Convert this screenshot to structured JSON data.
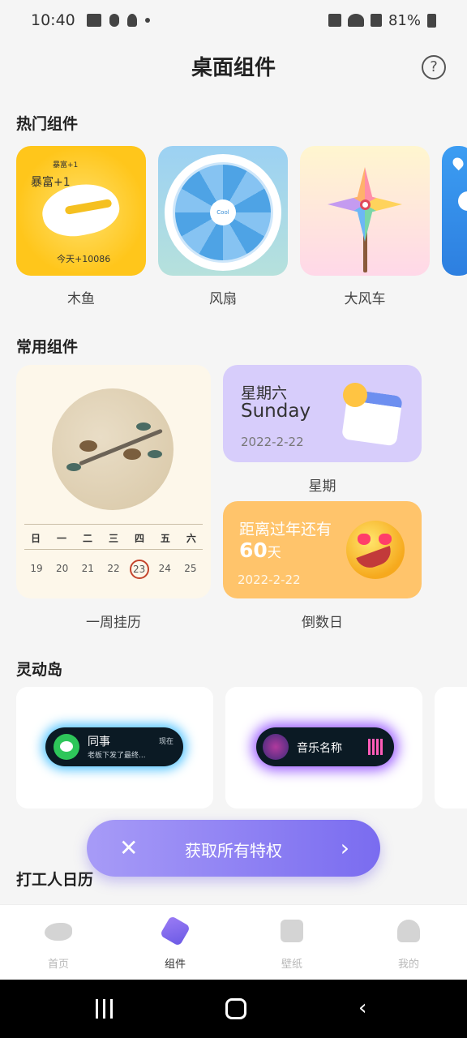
{
  "status": {
    "time": "10:40",
    "battery": "81%"
  },
  "header": {
    "title": "桌面组件",
    "help": "?"
  },
  "hot": {
    "title": "热门组件",
    "items": [
      {
        "label": "木鱼",
        "top_small": "暴富+1",
        "top": "暴富+1",
        "bottom": "今天+10086"
      },
      {
        "label": "风扇",
        "hub": "Cool"
      },
      {
        "label": "大风车"
      }
    ]
  },
  "common": {
    "title": "常用组件",
    "calendar": {
      "label": "一周挂历",
      "weekdays": [
        "日",
        "一",
        "二",
        "三",
        "四",
        "五",
        "六"
      ],
      "dates": [
        "19",
        "20",
        "21",
        "22",
        "23",
        "24",
        "25"
      ],
      "today_index": 4
    },
    "week": {
      "line1": "星期六",
      "line2": "Sunday",
      "date": "2022-2-22",
      "label": "星期"
    },
    "countdown": {
      "line1": "距离过年还有",
      "number": "60",
      "unit": "天",
      "date": "2022-2-22",
      "label": "倒数日"
    }
  },
  "island": {
    "title": "灵动岛",
    "wechat": {
      "name": "同事",
      "time": "现在",
      "message": "老板下发了最终..."
    },
    "music": {
      "name": "音乐名称"
    }
  },
  "work": {
    "title": "打工人日历"
  },
  "promo": {
    "close": "✕",
    "text": "获取所有特权",
    "arrow": "›"
  },
  "tabs": [
    {
      "label": "首页",
      "icon": "bird-icon",
      "active": false
    },
    {
      "label": "组件",
      "icon": "widget-icon",
      "active": true
    },
    {
      "label": "壁纸",
      "icon": "wallpaper-icon",
      "active": false
    },
    {
      "label": "我的",
      "icon": "profile-icon",
      "active": false
    }
  ],
  "nav": {
    "back": "‹"
  }
}
